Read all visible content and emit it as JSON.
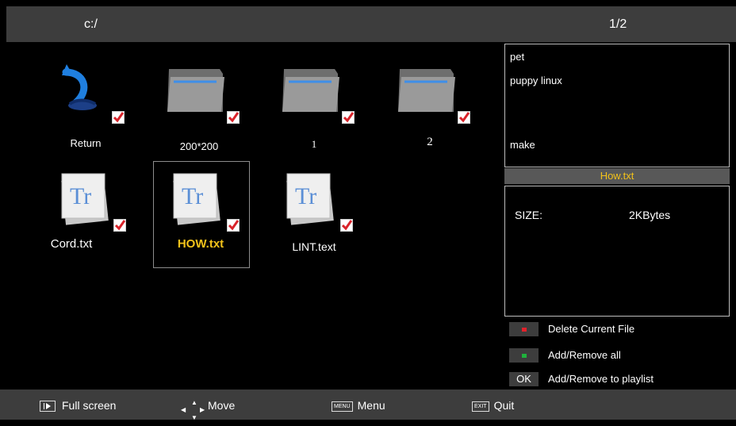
{
  "header": {
    "path": "c:/",
    "page": "1/2"
  },
  "tiles": [
    {
      "label": "Return",
      "kind": "return"
    },
    {
      "label": "200*200",
      "kind": "folder"
    },
    {
      "label": "1",
      "kind": "folder"
    },
    {
      "label": "2",
      "kind": "folder"
    },
    {
      "label": "Cord.txt",
      "kind": "text-file"
    },
    {
      "label": "HOW.txt",
      "kind": "text-file",
      "selected": true
    },
    {
      "label": "LINT.text",
      "kind": "text-file"
    }
  ],
  "side": {
    "list": [
      "pet",
      "puppy linux",
      "make"
    ],
    "filename": "How.txt",
    "size_label": "SIZE:",
    "size_value": "2KBytes"
  },
  "hints": [
    {
      "key": "red-button",
      "text": "Delete Current File"
    },
    {
      "key": "green-button",
      "text": "Add/Remove all"
    },
    {
      "key": "OK",
      "text": "Add/Remove to playlist"
    }
  ],
  "bottom": {
    "fullscreen": "Full screen",
    "move": "Move",
    "menu_key": "MENU",
    "menu": "Menu",
    "exit_key": "EXIT",
    "quit": "Quit"
  },
  "colors": {
    "bar": "#3d3d3d",
    "selected_text": "#f2c21a",
    "check": "#d9232a",
    "red_key": "#e2212b",
    "green_key": "#1fb23c"
  }
}
